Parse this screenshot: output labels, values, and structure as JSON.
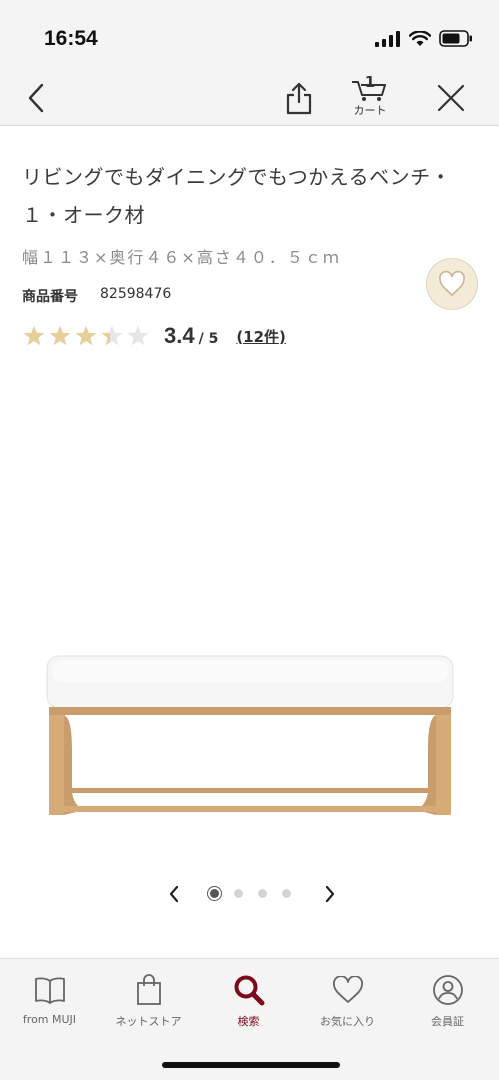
{
  "status_bar": {
    "time": "16:54"
  },
  "nav": {
    "back_icon": "chevron-left-icon",
    "share_icon": "share-icon",
    "cart_count": "1",
    "cart_label": "カート",
    "close_icon": "close-icon"
  },
  "product": {
    "title": "リビングでもダイニングでもつかえるベンチ・１・オーク材",
    "size": "幅１１３×奥行４６×高さ４０．５ｃｍ",
    "code_label": "商品番号",
    "code": "82598476",
    "rating": 3.4,
    "rating_value": "3.4",
    "rating_max": "/ 5",
    "review_count": "(12件)",
    "favorite_icon": "heart-icon"
  },
  "carousel": {
    "total": 4,
    "active_index": 0
  },
  "colors": {
    "accent": "#7a0a1c",
    "star_filled": "#e7cf9a",
    "star_empty": "#e6e6e6",
    "fav_bg": "#f3ead7"
  },
  "tabs": [
    {
      "label": "from MUJI",
      "icon": "book-icon",
      "active": false
    },
    {
      "label": "ネットストア",
      "icon": "shopping-bag-icon",
      "active": false
    },
    {
      "label": "検索",
      "icon": "search-icon",
      "active": true
    },
    {
      "label": "お気に入り",
      "icon": "heart-icon",
      "active": false
    },
    {
      "label": "会員証",
      "icon": "member-card-icon",
      "active": false
    }
  ]
}
